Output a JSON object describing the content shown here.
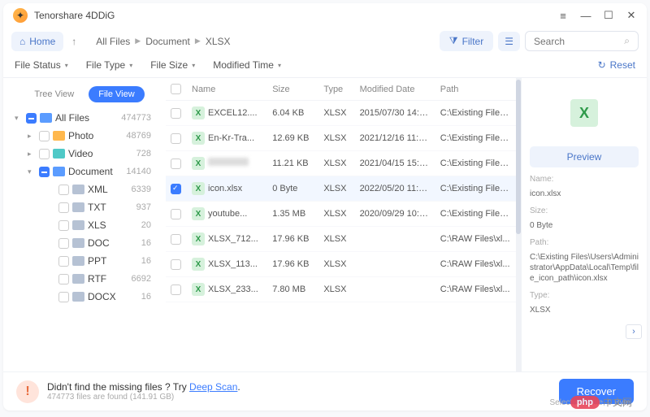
{
  "app": {
    "title": "Tenorshare 4DDiG"
  },
  "toolbar": {
    "home": "Home",
    "breadcrumb": [
      "All Files",
      "Document",
      "XLSX"
    ],
    "filter_label": "Filter",
    "search_placeholder": "Search"
  },
  "filters": {
    "status": "File Status",
    "type": "File Type",
    "size": "File Size",
    "modified": "Modified Time",
    "reset": "Reset"
  },
  "sidebar": {
    "tabs": {
      "tree": "Tree View",
      "file": "File View"
    },
    "items": [
      {
        "label": "All Files",
        "count": "474773",
        "icon": "blue",
        "expanded": true,
        "check": "some"
      },
      {
        "label": "Photo",
        "count": "48769",
        "icon": "yellow",
        "indent": 1
      },
      {
        "label": "Video",
        "count": "728",
        "icon": "teal",
        "indent": 1
      },
      {
        "label": "Document",
        "count": "14140",
        "icon": "blue",
        "indent": 1,
        "expanded": true,
        "check": "some"
      },
      {
        "label": "XML",
        "count": "6339",
        "icon": "gray",
        "indent": 2
      },
      {
        "label": "TXT",
        "count": "937",
        "icon": "gray",
        "indent": 2
      },
      {
        "label": "XLS",
        "count": "20",
        "icon": "gray",
        "indent": 2
      },
      {
        "label": "DOC",
        "count": "16",
        "icon": "gray",
        "indent": 2
      },
      {
        "label": "PPT",
        "count": "16",
        "icon": "gray",
        "indent": 2
      },
      {
        "label": "RTF",
        "count": "6692",
        "icon": "gray",
        "indent": 2
      },
      {
        "label": "DOCX",
        "count": "16",
        "icon": "gray",
        "indent": 2
      }
    ]
  },
  "table": {
    "headers": {
      "name": "Name",
      "size": "Size",
      "type": "Type",
      "modified": "Modified Date",
      "path": "Path"
    },
    "rows": [
      {
        "name": "EXCEL12....",
        "size": "6.04 KB",
        "type": "XLSX",
        "modified": "2015/07/30 14:24:24",
        "path": "C:\\Existing Files..."
      },
      {
        "name": "En-Kr-Tra...",
        "size": "12.69 KB",
        "type": "XLSX",
        "modified": "2021/12/16 11:49:56",
        "path": "C:\\Existing Files..."
      },
      {
        "name": "",
        "blurred": true,
        "size": "11.21 KB",
        "type": "XLSX",
        "modified": "2021/04/15 15:07:20",
        "path": "C:\\Existing Files..."
      },
      {
        "name": "icon.xlsx",
        "size": "0 Byte",
        "type": "XLSX",
        "modified": "2022/05/20 11:36:09",
        "path": "C:\\Existing Files...",
        "selected": true
      },
      {
        "name": "youtube...",
        "size": "1.35 MB",
        "type": "XLSX",
        "modified": "2020/09/29 10:55:08",
        "path": "C:\\Existing Files..."
      },
      {
        "name": "XLSX_712...",
        "size": "17.96 KB",
        "type": "XLSX",
        "modified": "",
        "path": "C:\\RAW Files\\xl..."
      },
      {
        "name": "XLSX_113...",
        "size": "17.96 KB",
        "type": "XLSX",
        "modified": "",
        "path": "C:\\RAW Files\\xl..."
      },
      {
        "name": "XLSX_233...",
        "size": "7.80 MB",
        "type": "XLSX",
        "modified": "",
        "path": "C:\\RAW Files\\xl..."
      }
    ]
  },
  "preview": {
    "button": "Preview",
    "labels": {
      "name": "Name:",
      "size": "Size:",
      "path": "Path:",
      "type": "Type:"
    },
    "name": "icon.xlsx",
    "size": "0 Byte",
    "path": "C:\\Existing Files\\Users\\Administrator\\AppData\\Local\\Temp\\file_icon_path\\icon.xlsx",
    "type": "XLSX"
  },
  "footer": {
    "title_a": "Didn't find the missing files ? Try ",
    "deep": "Deep Scan",
    "title_b": ".",
    "sub": "474773 files are found (141.91 GB)",
    "recover": "Recover",
    "selected": "Selected: 1 file, 0 Byte"
  },
  "watermark": {
    "badge": "php",
    "text": "中文网"
  }
}
